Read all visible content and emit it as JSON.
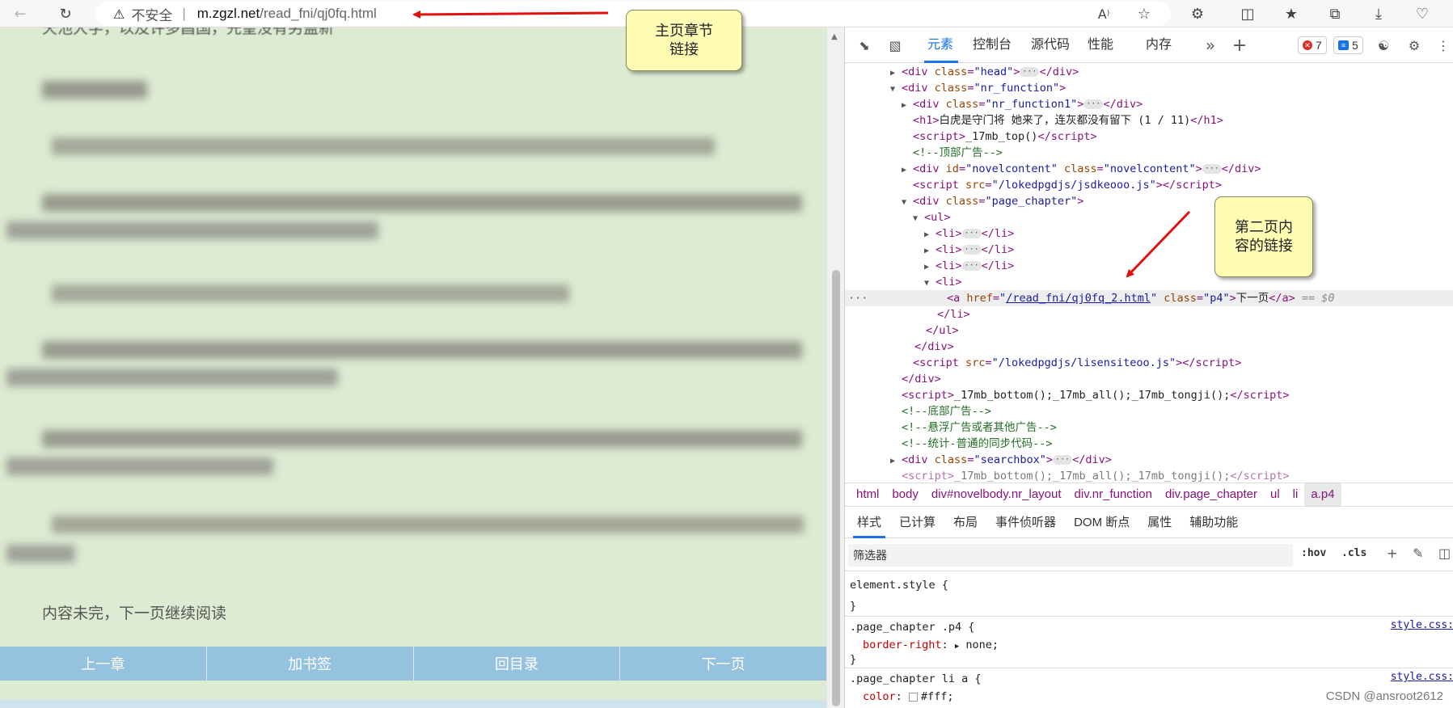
{
  "browser": {
    "security_icon": "warning-triangle-icon",
    "insecure_label": "不安全",
    "url_separator": "|",
    "url_host": "m.zgzl.net",
    "url_path": "/read_fni/qj0fq.html",
    "toolbar_icons": [
      "back-icon",
      "refresh-icon",
      "read-aloud-icon",
      "favorite-star-icon",
      "extensions-icon",
      "split-screen-icon",
      "favorites-icon",
      "collections-icon",
      "downloads-icon",
      "browser-essentials-icon"
    ],
    "read_aloud_label": "A"
  },
  "page": {
    "top_cut_text": "天池大学，以及许多昌国，先皇没有另盖新",
    "continue_text": "内容未完，下一页继续阅读",
    "nav": [
      "上一章",
      "加书签",
      "回目录",
      "下一页"
    ],
    "background_color": "#dcebd2",
    "nav_color": "#95c2df"
  },
  "callouts": {
    "main_link": "主页章节\n链接",
    "second_page": "第二页内\n容的链接"
  },
  "devtools": {
    "tabs": [
      "元素",
      "控制台",
      "源代码",
      "性能",
      "内存"
    ],
    "more_tabs": "»",
    "add_tab": "+",
    "errors_count": "7",
    "messages_count": "5",
    "dom": {
      "l1_tag": "div",
      "l1_attr": "class",
      "l1_val": "\"head\"",
      "l2_tag": "div",
      "l2_attr": "class",
      "l2_val": "\"nr_function\"",
      "l3_tag": "div",
      "l3_attr": "class",
      "l3_val": "\"nr_function1\"",
      "l4_text": "白虎是守门将 她来了，连灰都没有留下 (1 / 11)",
      "l5_text": "_17mb_top()",
      "l6_comment": "<!--顶部广告-->",
      "l7_tag": "div",
      "l7_attr1": "id",
      "l7_val1": "\"novelcontent\"",
      "l7_attr2": "class",
      "l7_val2": "\"novelcontent\"",
      "l8_attr": "src",
      "l8_val": "\"/lokedpgdjs/jsdkeooo.js\"",
      "l9_tag": "div",
      "l9_attr": "class",
      "l9_val": "\"page_chapter\"",
      "l10_tag": "ul",
      "l11_tag": "li",
      "l12_tag": "li",
      "l13_tag": "li",
      "l14_tag": "li",
      "l15_attr1": "href",
      "l15_href": "/read_fni/qj0fq_2.html",
      "l15_attr2": "class",
      "l15_val2": "\"p4\"",
      "l15_text": "下一页",
      "l15_eq": "== $0",
      "l16_close": "</li>",
      "l17_close": "</ul>",
      "l18_close": "</div>",
      "l19_attr": "src",
      "l19_val": "\"/lokedpgdjs/lisensiteoo.js\"",
      "l20_close": "</div>",
      "l21_text": "_17mb_bottom();_17mb_all();_17mb_tongji();",
      "l22_comment": "<!--底部广告-->",
      "l23_comment": "<!--悬浮广告或者其他广告-->",
      "l24_comment": "<!--统计-普通的同步代码-->",
      "l25_tag": "div",
      "l25_attr": "class",
      "l25_val": "\"searchbox\"",
      "l26_text": "_17mb_bottom();_17mb_all();_17mb_tongji();"
    },
    "breadcrumbs": [
      "html",
      "body",
      "div#novelbody.nr_layout",
      "div.nr_function",
      "div.page_chapter",
      "ul",
      "li",
      "a.p4"
    ],
    "style_tabs": [
      "样式",
      "已计算",
      "布局",
      "事件侦听器",
      "DOM 断点",
      "属性",
      "辅助功能"
    ],
    "filter_placeholder": "筛选器",
    "hov": ":hov",
    "cls": ".cls",
    "rules": {
      "element_style": "element.style {",
      "close_brace": "}",
      "r1_selector": ".page_chapter .p4 {",
      "r1_prop": "border-right",
      "r1_value": "none;",
      "r1_source": "style.css:",
      "r2_selector": ".page_chapter li a {",
      "r2_prop": "color",
      "r2_value": "#fff;",
      "r2_source": "style.css:"
    }
  },
  "watermark": "CSDN @ansroot2612"
}
